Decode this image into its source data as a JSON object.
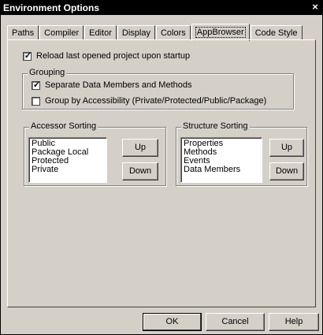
{
  "window": {
    "title": "Environment Options",
    "close_glyph": "×"
  },
  "tabs": [
    {
      "label": "Paths",
      "active": false
    },
    {
      "label": "Compiler",
      "active": false
    },
    {
      "label": "Editor",
      "active": false
    },
    {
      "label": "Display",
      "active": false
    },
    {
      "label": "Colors",
      "active": false
    },
    {
      "label": "AppBrowser",
      "active": true
    },
    {
      "label": "Code Style",
      "active": false
    }
  ],
  "reload_option": {
    "label": "Reload last opened project upon startup",
    "checked": true
  },
  "grouping": {
    "title": "Grouping",
    "separate": {
      "label": "Separate Data Members and Methods",
      "checked": true
    },
    "by_access": {
      "label": "Group by Accessibility (Private/Protected/Public/Package)",
      "checked": false
    }
  },
  "accessor_sorting": {
    "title": "Accessor Sorting",
    "items": [
      "Public",
      "Package Local",
      "Protected",
      "Private"
    ],
    "up": "Up",
    "down": "Down"
  },
  "structure_sorting": {
    "title": "Structure Sorting",
    "items": [
      "Properties",
      "Methods",
      "Events",
      "Data Members"
    ],
    "up": "Up",
    "down": "Down"
  },
  "footer": {
    "ok": "OK",
    "cancel": "Cancel",
    "help": "Help"
  }
}
